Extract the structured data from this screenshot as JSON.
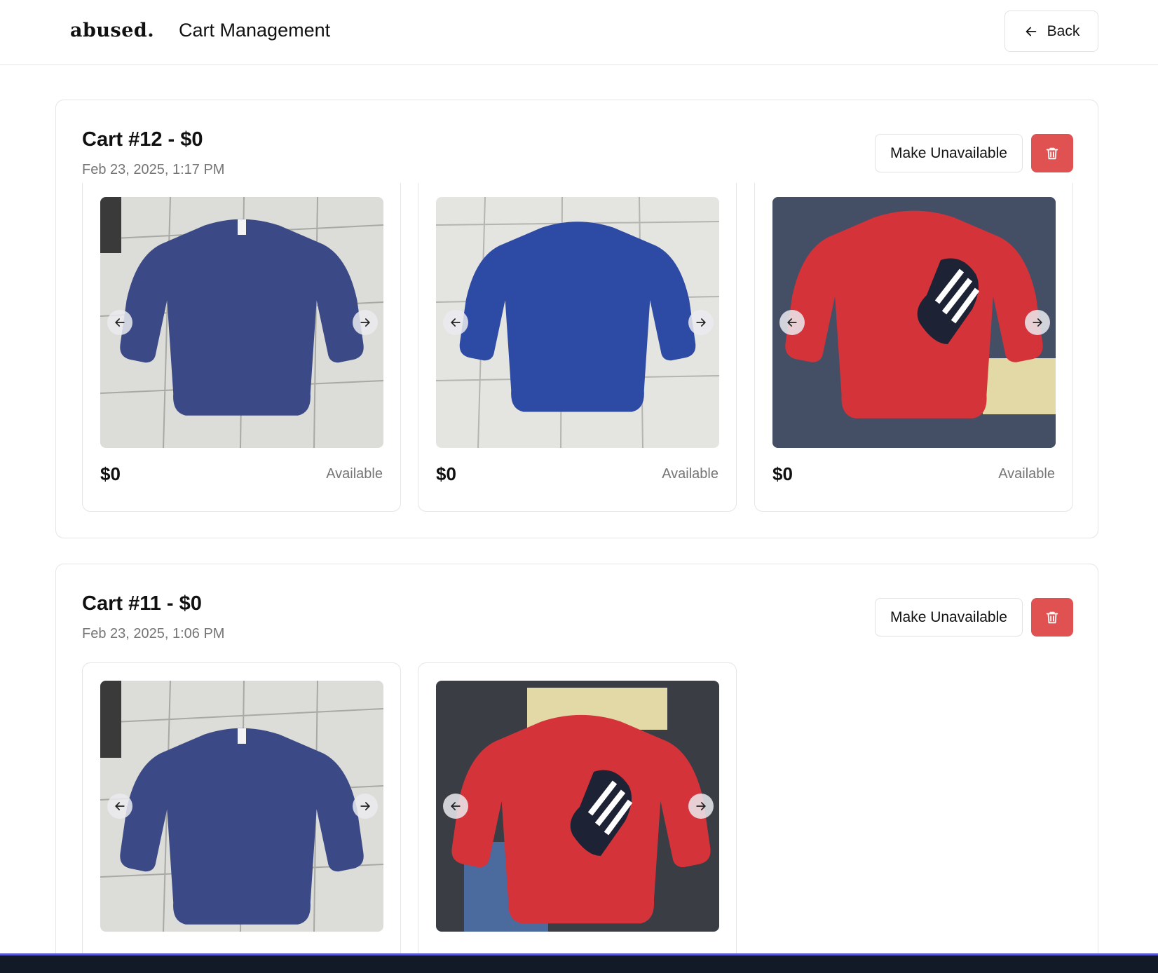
{
  "header": {
    "logo": "abused.",
    "title": "Cart Management",
    "back_label": "Back",
    "back_icon": "arrow-left-icon"
  },
  "colors": {
    "danger": "#e05252",
    "muted_text": "#757575",
    "border": "#e5e5e5"
  },
  "carts": [
    {
      "title": "Cart #12 - $0",
      "date": "Feb 23, 2025, 1:17 PM",
      "make_unavailable_label": "Make Unavailable",
      "delete_icon": "trash-icon",
      "items": [
        {
          "price": "$0",
          "status": "Available",
          "photo": "navy-champion-sweatshirt"
        },
        {
          "price": "$0",
          "status": "Available",
          "photo": "blue-crewneck-sweatshirt"
        },
        {
          "price": "$0",
          "status": "Available",
          "photo": "red-heart-sweatshirt"
        }
      ]
    },
    {
      "title": "Cart #11 - $0",
      "date": "Feb 23, 2025, 1:06 PM",
      "make_unavailable_label": "Make Unavailable",
      "delete_icon": "trash-icon",
      "items": [
        {
          "photo": "navy-champion-sweatshirt"
        },
        {
          "photo": "red-heart-sweatshirt"
        }
      ]
    }
  ]
}
